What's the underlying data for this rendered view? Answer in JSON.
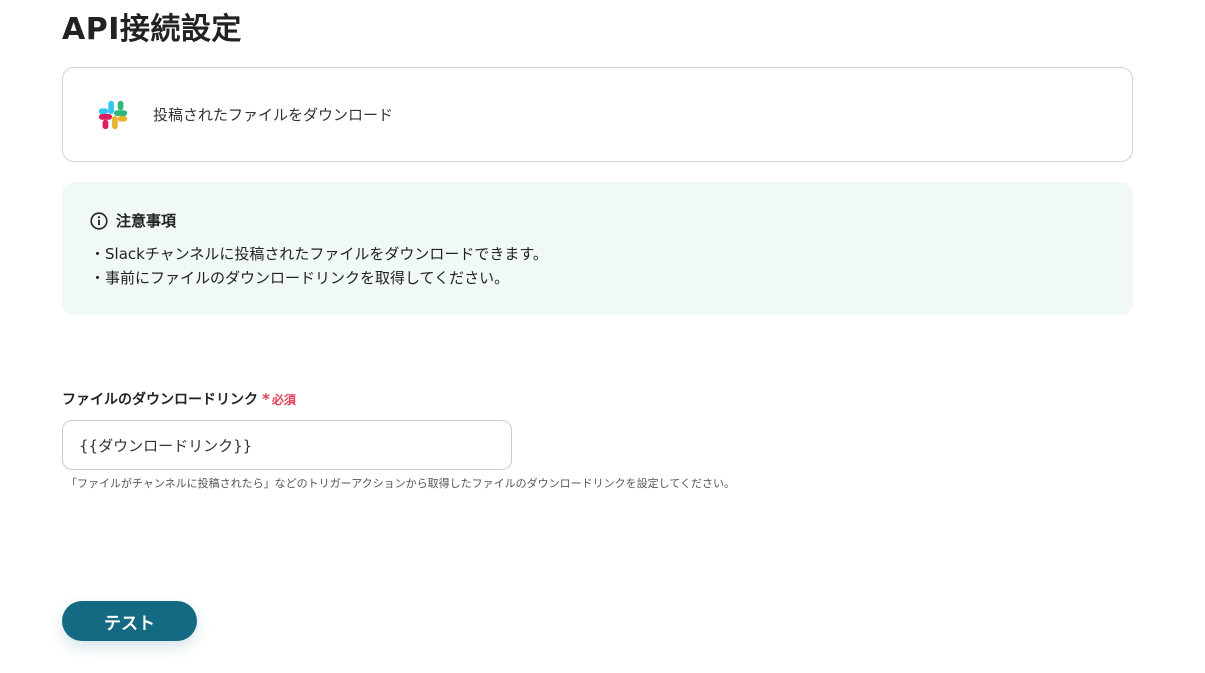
{
  "page": {
    "title": "API接続設定"
  },
  "action": {
    "icon": "slack-logo",
    "label": "投稿されたファイルをダウンロード"
  },
  "notice": {
    "icon": "info-icon",
    "title": "注意事項",
    "lines": [
      "・Slackチャンネルに投稿されたファイルをダウンロードできます。",
      "・事前にファイルのダウンロードリンクを取得してください。"
    ]
  },
  "field": {
    "label": "ファイルのダウンロードリンク",
    "required_mark": "*",
    "required_text": "必須",
    "value": "{{ダウンロードリンク}}",
    "help": "「ファイルがチャンネルに投稿されたら」などのトリガーアクションから取得したファイルのダウンロードリンクを設定してください。"
  },
  "buttons": {
    "test_label": "テスト"
  },
  "colors": {
    "accent": "#146a82",
    "required": "#e0425a",
    "notice_bg": "#f1f8f8",
    "slack_blue": "#36c5f0",
    "slack_green": "#2eb67d",
    "slack_yellow": "#ecb22e",
    "slack_red": "#e01e5a"
  }
}
